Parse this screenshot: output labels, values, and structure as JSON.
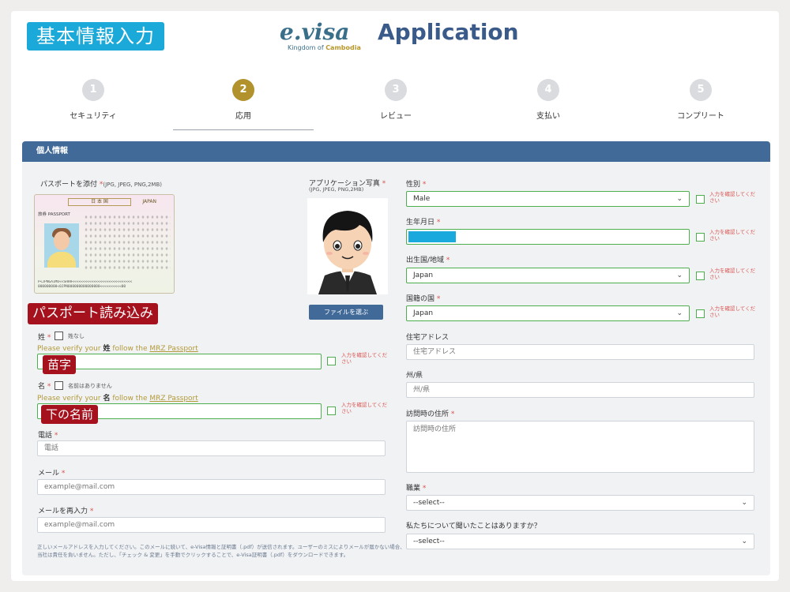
{
  "overlay_labels": {
    "basic_info": "基本情報入力",
    "passport_read": "パスポート読み込み",
    "surname": "苗字",
    "given_name": "下の名前"
  },
  "header": {
    "logo_main": "e.visa",
    "logo_sub_prefix": "Kingdom of ",
    "logo_sub_bold": "Cambodia",
    "title": "Application"
  },
  "steps": [
    {
      "num": "1",
      "label": "セキュリティ"
    },
    {
      "num": "2",
      "label": "応用"
    },
    {
      "num": "3",
      "label": "レビュー"
    },
    {
      "num": "4",
      "label": "支払い"
    },
    {
      "num": "5",
      "label": "コンプリート"
    }
  ],
  "active_step": 2,
  "section_title": "個人情報",
  "left": {
    "passport_attach_label": "パスポートを添付",
    "passport_attach_req": "*",
    "passport_attach_format": "(JPG, JPEG, PNG,2MB)",
    "passport_image": {
      "strip": "日 本 国",
      "japan": "JAPAN",
      "type": "旅券 PASSPORT",
      "mrz1": "P<JPNGAIMU<<SHHH<<<<<<<<<<<<<<<<<<<<<<<<<<<<",
      "mrz2": "000000000<0JPN000000000000000<<<<<<<<<<00"
    },
    "photo_label": "アプリケーション写真",
    "photo_req": "*",
    "photo_format": "(JPG, JPEG, PNG,2MB)",
    "file_button": "ファイルを選ぶ",
    "surname_label": "姓",
    "surname_req": "*",
    "surname_none": "姓なし",
    "surname_hint_pre": "Please verify your ",
    "surname_hint_key": "姓",
    "surname_hint_mid": " follow the ",
    "surname_hint_link": "MRZ Passport",
    "given_label": "名",
    "given_req": "*",
    "given_none": "名前はありません",
    "given_hint_pre": "Please verify your ",
    "given_hint_key": "名",
    "given_hint_mid": " follow the ",
    "given_hint_link": "MRZ Passport",
    "verify_text": "入力を確認してください",
    "phone_label": "電話",
    "phone_req": "*",
    "phone_placeholder": "電話",
    "email_label": "メール",
    "email_req": "*",
    "email_placeholder": "example@mail.com",
    "email_confirm_label": "メールを再入力",
    "email_confirm_req": "*",
    "email_confirm_placeholder": "example@mail.com",
    "note": "正しいメールアドレスを入力してください。このメールに続いて、e-Visa情報と証明書（.pdf）が送信されます。ユーザーのミスによりメールが届かない場合、当社は責任を負いません。ただし、「チェック & 変更」を手動でクリックすることで、e-Visa証明書（.pdf）をダウンロードできます。"
  },
  "right": {
    "gender_label": "性別",
    "gender_req": "*",
    "gender_value": "Male",
    "dob_label": "生年月日",
    "dob_req": "*",
    "birth_country_label": "出生国/地域",
    "birth_country_req": "*",
    "birth_country_value": "Japan",
    "nationality_label": "国籍の国",
    "nationality_req": "*",
    "nationality_value": "Japan",
    "address_label": "住宅アドレス",
    "address_placeholder": "住宅アドレス",
    "state_label": "州/県",
    "state_placeholder": "州/県",
    "visit_address_label": "訪問時の住所",
    "visit_address_req": "*",
    "visit_address_placeholder": "訪問時の住所",
    "occupation_label": "職業",
    "occupation_req": "*",
    "occupation_value": "--select--",
    "heard_label": "私たちについて聞いたことはありますか？",
    "heard_value": "--select--",
    "verify_text": "入力を確認してください"
  },
  "colors": {
    "accent_blue": "#416a99",
    "active_step": "#b2922c",
    "tag_cyan": "#1aa9d8",
    "tag_red": "#a5121e",
    "valid_green": "#4cae4c"
  },
  "icons": {
    "select_chevron": "chevron-down-icon",
    "checkbox": "checkbox-icon"
  }
}
